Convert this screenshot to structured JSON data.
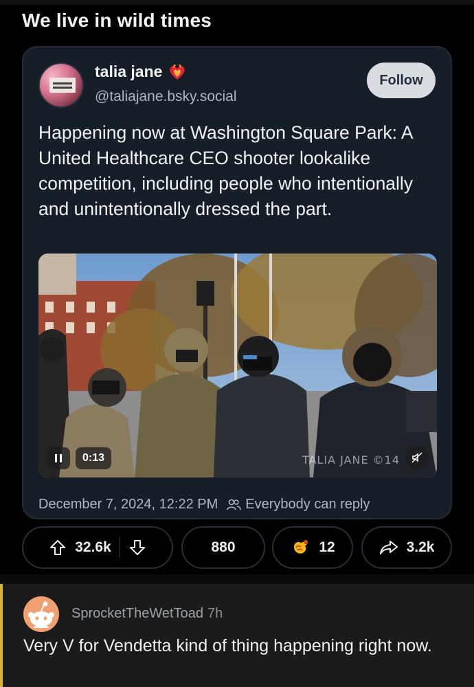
{
  "post": {
    "title": "We live in wild times"
  },
  "embed": {
    "author": {
      "display_name": "talia jane",
      "handle": "@taliajane.bsky.social",
      "avatar": "avatar"
    },
    "follow_label": "Follow",
    "text": "Happening now at Washington Square Park: A United Healthcare CEO shooter lookalike competition, including people who intentionally and unintentionally dressed the part.",
    "video": {
      "time": "0:13",
      "watermark": "TALIA JANE ©14"
    },
    "date": "December 7, 2024, 12:22 PM",
    "reply_setting": "Everybody can reply"
  },
  "actions": {
    "upvotes": "32.6k",
    "comments": "880",
    "awards": "12",
    "shares": "3.2k"
  },
  "comment": {
    "author": "SprocketTheWetToad",
    "time": "7h",
    "text": "Very V for Vendetta kind of thing happening right now."
  },
  "colors": {
    "card_bg": "#161e27",
    "follow_bg": "#d9dde2",
    "comment_accent": "#d8b23c"
  }
}
